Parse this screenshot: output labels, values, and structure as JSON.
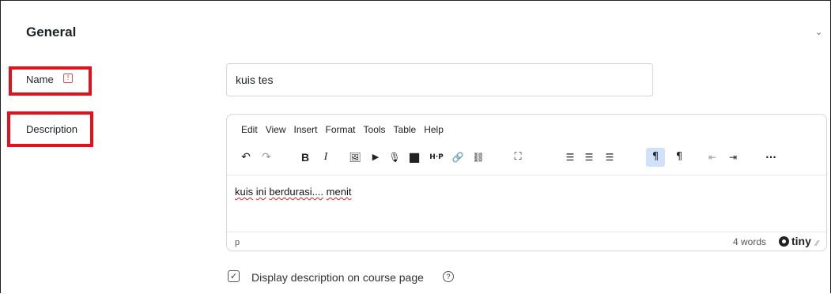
{
  "section": {
    "title": "General"
  },
  "fields": {
    "name_label": "Name",
    "required_mark": "!",
    "name_value": "kuis tes",
    "description_label": "Description"
  },
  "editor": {
    "menu": [
      "Edit",
      "View",
      "Insert",
      "Format",
      "Tools",
      "Table",
      "Help"
    ],
    "toolbar": {
      "undo": "↶",
      "redo": "↷",
      "bold": "B",
      "italic": "I",
      "image": "🖼",
      "media": "▶",
      "record_audio": "🎙",
      "record_video": "■",
      "h5p": "H·P",
      "link": "🔗",
      "unlink": "⛓",
      "fullscreen": "⛶",
      "align_left": "☰",
      "align_center": "☰",
      "align_right": "☰",
      "ltr": "¶",
      "rtl": "¶",
      "outdent": "⇤",
      "indent": "⇥",
      "more": "···"
    },
    "content_words": [
      "kuis",
      "ini",
      "berdurasi....",
      "menit"
    ],
    "status_path": "p",
    "word_count": "4 words",
    "brand": "tiny",
    "resize": "⁄⁄"
  },
  "display_description": {
    "checked": true,
    "check_glyph": "✓",
    "label": "Display description on course page",
    "help_glyph": "?"
  },
  "colors": {
    "highlight": "#e0121b",
    "active_tool": "#cfe2fa"
  }
}
